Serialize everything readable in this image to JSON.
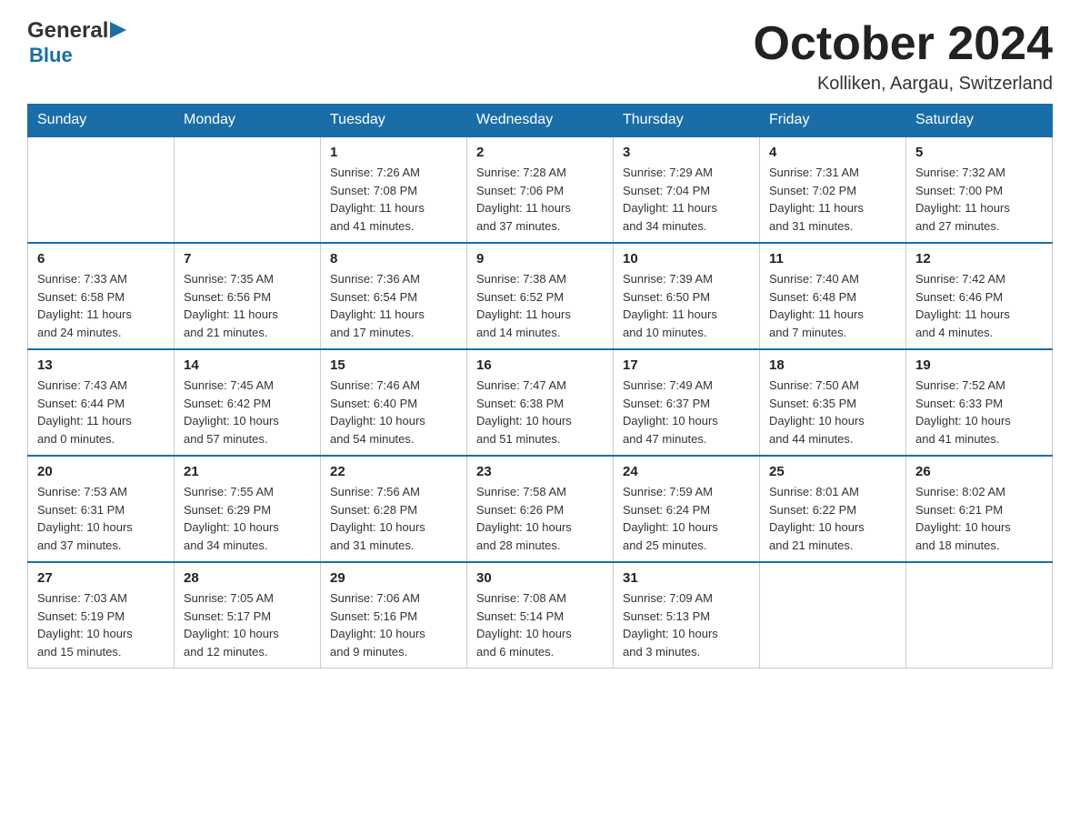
{
  "header": {
    "logo_general": "General",
    "logo_blue": "Blue",
    "month_title": "October 2024",
    "location": "Kolliken, Aargau, Switzerland"
  },
  "weekdays": [
    "Sunday",
    "Monday",
    "Tuesday",
    "Wednesday",
    "Thursday",
    "Friday",
    "Saturday"
  ],
  "weeks": [
    [
      {
        "day": "",
        "detail": ""
      },
      {
        "day": "",
        "detail": ""
      },
      {
        "day": "1",
        "detail": "Sunrise: 7:26 AM\nSunset: 7:08 PM\nDaylight: 11 hours\nand 41 minutes."
      },
      {
        "day": "2",
        "detail": "Sunrise: 7:28 AM\nSunset: 7:06 PM\nDaylight: 11 hours\nand 37 minutes."
      },
      {
        "day": "3",
        "detail": "Sunrise: 7:29 AM\nSunset: 7:04 PM\nDaylight: 11 hours\nand 34 minutes."
      },
      {
        "day": "4",
        "detail": "Sunrise: 7:31 AM\nSunset: 7:02 PM\nDaylight: 11 hours\nand 31 minutes."
      },
      {
        "day": "5",
        "detail": "Sunrise: 7:32 AM\nSunset: 7:00 PM\nDaylight: 11 hours\nand 27 minutes."
      }
    ],
    [
      {
        "day": "6",
        "detail": "Sunrise: 7:33 AM\nSunset: 6:58 PM\nDaylight: 11 hours\nand 24 minutes."
      },
      {
        "day": "7",
        "detail": "Sunrise: 7:35 AM\nSunset: 6:56 PM\nDaylight: 11 hours\nand 21 minutes."
      },
      {
        "day": "8",
        "detail": "Sunrise: 7:36 AM\nSunset: 6:54 PM\nDaylight: 11 hours\nand 17 minutes."
      },
      {
        "day": "9",
        "detail": "Sunrise: 7:38 AM\nSunset: 6:52 PM\nDaylight: 11 hours\nand 14 minutes."
      },
      {
        "day": "10",
        "detail": "Sunrise: 7:39 AM\nSunset: 6:50 PM\nDaylight: 11 hours\nand 10 minutes."
      },
      {
        "day": "11",
        "detail": "Sunrise: 7:40 AM\nSunset: 6:48 PM\nDaylight: 11 hours\nand 7 minutes."
      },
      {
        "day": "12",
        "detail": "Sunrise: 7:42 AM\nSunset: 6:46 PM\nDaylight: 11 hours\nand 4 minutes."
      }
    ],
    [
      {
        "day": "13",
        "detail": "Sunrise: 7:43 AM\nSunset: 6:44 PM\nDaylight: 11 hours\nand 0 minutes."
      },
      {
        "day": "14",
        "detail": "Sunrise: 7:45 AM\nSunset: 6:42 PM\nDaylight: 10 hours\nand 57 minutes."
      },
      {
        "day": "15",
        "detail": "Sunrise: 7:46 AM\nSunset: 6:40 PM\nDaylight: 10 hours\nand 54 minutes."
      },
      {
        "day": "16",
        "detail": "Sunrise: 7:47 AM\nSunset: 6:38 PM\nDaylight: 10 hours\nand 51 minutes."
      },
      {
        "day": "17",
        "detail": "Sunrise: 7:49 AM\nSunset: 6:37 PM\nDaylight: 10 hours\nand 47 minutes."
      },
      {
        "day": "18",
        "detail": "Sunrise: 7:50 AM\nSunset: 6:35 PM\nDaylight: 10 hours\nand 44 minutes."
      },
      {
        "day": "19",
        "detail": "Sunrise: 7:52 AM\nSunset: 6:33 PM\nDaylight: 10 hours\nand 41 minutes."
      }
    ],
    [
      {
        "day": "20",
        "detail": "Sunrise: 7:53 AM\nSunset: 6:31 PM\nDaylight: 10 hours\nand 37 minutes."
      },
      {
        "day": "21",
        "detail": "Sunrise: 7:55 AM\nSunset: 6:29 PM\nDaylight: 10 hours\nand 34 minutes."
      },
      {
        "day": "22",
        "detail": "Sunrise: 7:56 AM\nSunset: 6:28 PM\nDaylight: 10 hours\nand 31 minutes."
      },
      {
        "day": "23",
        "detail": "Sunrise: 7:58 AM\nSunset: 6:26 PM\nDaylight: 10 hours\nand 28 minutes."
      },
      {
        "day": "24",
        "detail": "Sunrise: 7:59 AM\nSunset: 6:24 PM\nDaylight: 10 hours\nand 25 minutes."
      },
      {
        "day": "25",
        "detail": "Sunrise: 8:01 AM\nSunset: 6:22 PM\nDaylight: 10 hours\nand 21 minutes."
      },
      {
        "day": "26",
        "detail": "Sunrise: 8:02 AM\nSunset: 6:21 PM\nDaylight: 10 hours\nand 18 minutes."
      }
    ],
    [
      {
        "day": "27",
        "detail": "Sunrise: 7:03 AM\nSunset: 5:19 PM\nDaylight: 10 hours\nand 15 minutes."
      },
      {
        "day": "28",
        "detail": "Sunrise: 7:05 AM\nSunset: 5:17 PM\nDaylight: 10 hours\nand 12 minutes."
      },
      {
        "day": "29",
        "detail": "Sunrise: 7:06 AM\nSunset: 5:16 PM\nDaylight: 10 hours\nand 9 minutes."
      },
      {
        "day": "30",
        "detail": "Sunrise: 7:08 AM\nSunset: 5:14 PM\nDaylight: 10 hours\nand 6 minutes."
      },
      {
        "day": "31",
        "detail": "Sunrise: 7:09 AM\nSunset: 5:13 PM\nDaylight: 10 hours\nand 3 minutes."
      },
      {
        "day": "",
        "detail": ""
      },
      {
        "day": "",
        "detail": ""
      }
    ]
  ]
}
